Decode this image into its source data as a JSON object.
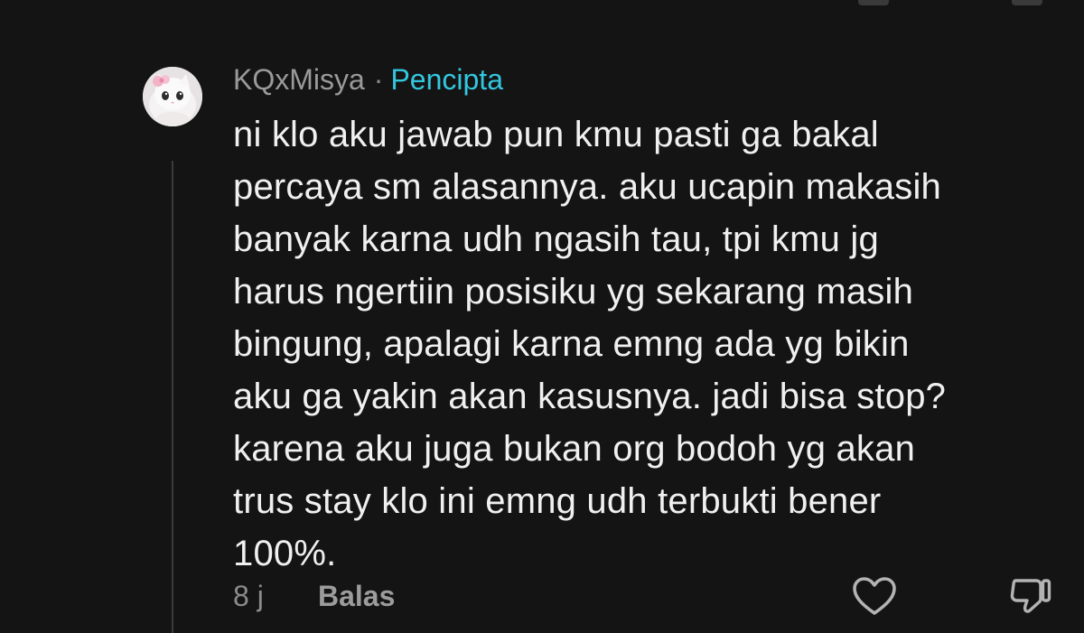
{
  "comment": {
    "username": "KQxMisya",
    "separator": "·",
    "badge": "Pencipta",
    "avatar_icon": "white-cat-with-pink-bow",
    "body_lines": [
      "ni klo aku jawab pun kmu pasti ga bakal",
      "percaya sm alasannya. aku ucapin makasih",
      "banyak karna udh ngasih tau, tpi kmu jg",
      "harus ngertiin posisiku yg sekarang masih",
      "bingung, apalagi karna emng ada yg bikin",
      "aku ga yakin akan kasusnya. jadi bisa stop?",
      "karena aku juga bukan org bodoh yg akan",
      "trus stay klo ini emng udh terbukti bener",
      "100%."
    ],
    "timestamp": "8 j",
    "reply_label": "Balas",
    "like_icon": "heart-outline-icon",
    "dislike_icon": "thumbs-down-outline-icon"
  },
  "colors": {
    "background": "#141414",
    "username": "#9a9a9a",
    "badge": "#33c7df",
    "body_text": "#f0f0f0",
    "muted": "#8c8c8c"
  }
}
